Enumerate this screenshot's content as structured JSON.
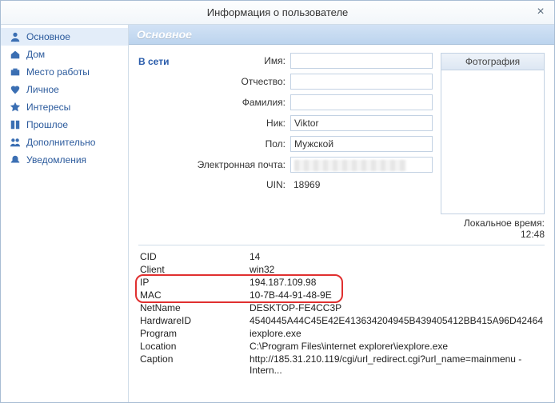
{
  "window": {
    "title": "Информация о пользователе"
  },
  "sidebar": {
    "items": [
      {
        "label": "Основное",
        "icon": "person-icon",
        "active": true
      },
      {
        "label": "Дом",
        "icon": "home-icon"
      },
      {
        "label": "Место работы",
        "icon": "briefcase-icon"
      },
      {
        "label": "Личное",
        "icon": "heart-icon"
      },
      {
        "label": "Интересы",
        "icon": "star-icon"
      },
      {
        "label": "Прошлое",
        "icon": "book-icon"
      },
      {
        "label": "Дополнительно",
        "icon": "people-icon"
      },
      {
        "label": "Уведомления",
        "icon": "bell-icon"
      }
    ]
  },
  "section": {
    "title": "Основное"
  },
  "form": {
    "status": "В сети",
    "name_label": "Имя:",
    "name": "",
    "middle_label": "Отчество:",
    "middle": "",
    "surname_label": "Фамилия:",
    "surname": "",
    "nick_label": "Ник:",
    "nick": "Viktor",
    "gender_label": "Пол:",
    "gender": "Мужской",
    "email_label": "Электронная почта:",
    "email_hidden": true,
    "uin_label": "UIN:",
    "uin": "18969"
  },
  "photo": {
    "header": "Фотография"
  },
  "local_time": {
    "label": "Локальное время:",
    "value": "12:48"
  },
  "system": {
    "rows": [
      {
        "k": "CID",
        "v": "14"
      },
      {
        "k": "Client",
        "v": "win32"
      },
      {
        "k": "IP",
        "v": "194.187.109.98"
      },
      {
        "k": "MAC",
        "v": "10-7B-44-91-48-9E"
      },
      {
        "k": "NetName",
        "v": "DESKTOP-FE4CC3P"
      },
      {
        "k": "HardwareID",
        "v": "4540445A44C45E42E413634204945B439405412BB415A96D42464"
      },
      {
        "k": "Program",
        "v": "iexplore.exe"
      },
      {
        "k": "Location",
        "v": "C:\\Program Files\\internet explorer\\iexplore.exe"
      },
      {
        "k": "Caption",
        "v": "http://185.31.210.119/cgi/url_redirect.cgi?url_name=mainmenu - Intern..."
      }
    ],
    "highlight_rows": [
      2,
      3
    ]
  }
}
